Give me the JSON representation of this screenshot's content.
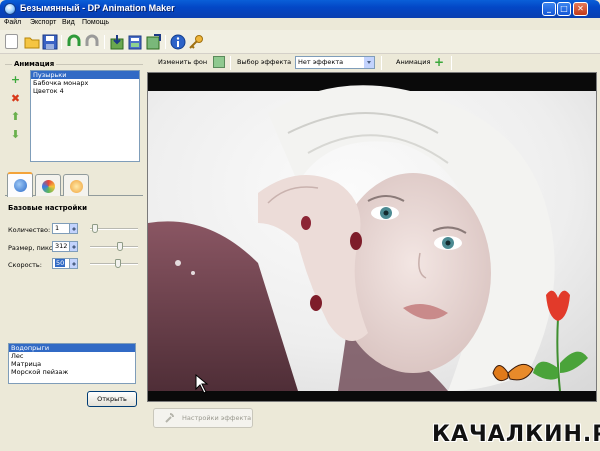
{
  "window": {
    "title": "Безымянный - DP Animation Maker",
    "controls": {
      "minimize": "_",
      "maximize": "□",
      "close": "✕"
    }
  },
  "menu": [
    "Файл",
    "Экспорт",
    "Вид",
    "Помощь"
  ],
  "toolbar": {
    "icons": [
      "new-icon",
      "open-folder-icon",
      "save-icon",
      "undo-icon",
      "redo-icon",
      "import-icon",
      "export-icon",
      "export-image-icon",
      "info-icon",
      "key-icon"
    ]
  },
  "animation_panel": {
    "title": "Анимация",
    "items": [
      {
        "label": "Пузырьки",
        "selected": true
      },
      {
        "label": "Бабочка монарх",
        "selected": false
      },
      {
        "label": "Цветок 4",
        "selected": false
      }
    ]
  },
  "settings": {
    "title": "Базовые настройки",
    "fields": [
      {
        "label": "Количество:",
        "value": "1",
        "slider_fraction": 0.05
      },
      {
        "label": "Размер, пикс:",
        "value": "312",
        "slider_fraction": 0.65
      },
      {
        "label": "Скорость:",
        "value": "50",
        "slider_fraction": 0.6,
        "selected": true
      }
    ]
  },
  "effect_list": {
    "items": [
      {
        "label": "Водопрыги",
        "selected": true
      },
      {
        "label": "Лес",
        "selected": false
      },
      {
        "label": "Матрица",
        "selected": false
      },
      {
        "label": "Морской пейзаж",
        "selected": false
      }
    ],
    "open_button": "Открыть"
  },
  "effect_bar": {
    "change_bg_label": "Изменить фон",
    "choose_effect_label": "Выбор эффекта",
    "effect_value": "Нет эффекта",
    "animation_label": "Анимация"
  },
  "effect_settings_button": "Настройки эффекта",
  "watermark": "КАЧАЛКИН.РУ",
  "colors": {
    "titlebar": "#0347c6",
    "selection": "#316ac5",
    "add_green": "#3aa83a",
    "delete_red": "#d83a1a"
  }
}
